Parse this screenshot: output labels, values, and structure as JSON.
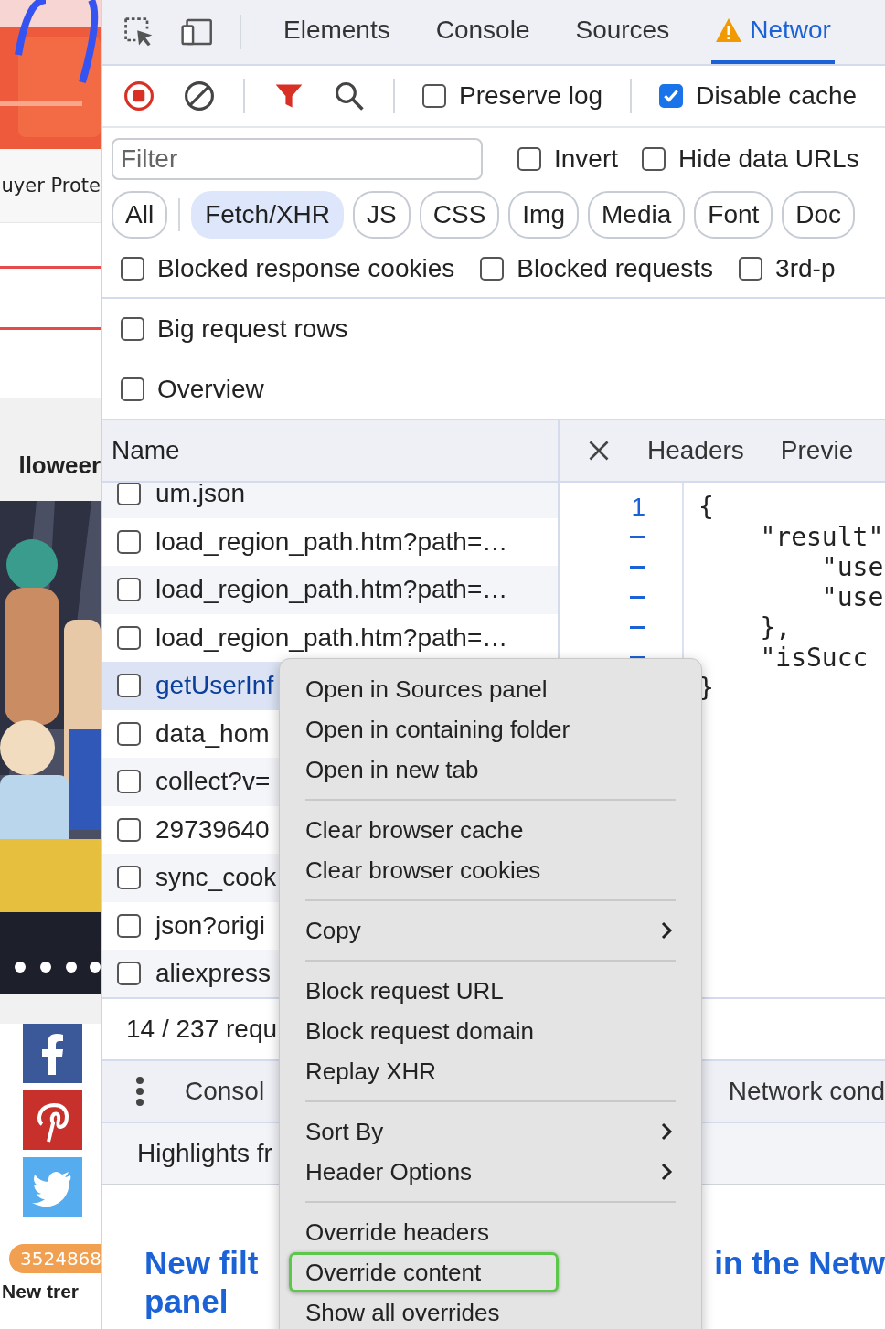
{
  "page": {
    "buyer_text": "uyer Prote",
    "heading": "lloweer",
    "social": [
      {
        "kind": "facebook"
      },
      {
        "kind": "pinterest"
      },
      {
        "kind": "twitter"
      }
    ],
    "count_badge": "3524868",
    "headline": "New trer"
  },
  "devtools": {
    "tabs": [
      {
        "label": "Elements",
        "selected": false,
        "warning": false
      },
      {
        "label": "Console",
        "selected": false,
        "warning": false
      },
      {
        "label": "Sources",
        "selected": false,
        "warning": false
      },
      {
        "label": "Networ",
        "selected": true,
        "warning": true
      }
    ],
    "preserve_log": {
      "label": "Preserve log",
      "checked": false
    },
    "disable_cache": {
      "label": "Disable cache",
      "checked": true
    },
    "filter": {
      "placeholder": "Filter"
    },
    "filter_options": [
      {
        "label": "Invert",
        "checked": false
      },
      {
        "label": "Hide data URLs",
        "checked": false
      }
    ],
    "types": [
      {
        "label": "All",
        "selected": false
      },
      {
        "label": "Fetch/XHR",
        "selected": true
      },
      {
        "label": "JS",
        "selected": false
      },
      {
        "label": "CSS",
        "selected": false
      },
      {
        "label": "Img",
        "selected": false
      },
      {
        "label": "Media",
        "selected": false
      },
      {
        "label": "Font",
        "selected": false
      },
      {
        "label": "Doc",
        "selected": false
      }
    ],
    "blocked_options": [
      {
        "label": "Blocked response cookies",
        "checked": false
      },
      {
        "label": "Blocked requests",
        "checked": false
      },
      {
        "label": "3rd-p",
        "checked": false
      }
    ],
    "options": [
      {
        "label": "Big request rows",
        "checked": false
      },
      {
        "label": "Overview",
        "checked": false
      }
    ],
    "name_header": "Name",
    "detail_tabs": [
      "Headers",
      "Previe"
    ],
    "requests": [
      {
        "name": "um.json",
        "selected": false,
        "checked": false
      },
      {
        "name": "load_region_path.htm?path=…",
        "selected": false,
        "checked": false
      },
      {
        "name": "load_region_path.htm?path=…",
        "selected": false,
        "checked": false
      },
      {
        "name": "load_region_path.htm?path=…",
        "selected": false,
        "checked": false
      },
      {
        "name": "getUserInf",
        "selected": true,
        "checked": false
      },
      {
        "name": "data_hom",
        "selected": false,
        "checked": false
      },
      {
        "name": "collect?v=",
        "selected": false,
        "checked": false
      },
      {
        "name": "29739640",
        "selected": false,
        "checked": false
      },
      {
        "name": "sync_cook",
        "selected": false,
        "checked": false
      },
      {
        "name": "json?origi",
        "selected": false,
        "checked": false
      },
      {
        "name": "aliexpress",
        "selected": false,
        "checked": false
      }
    ],
    "preview": {
      "line_number": "1",
      "lines": [
        "{",
        "    \"result\"",
        "        \"use",
        "        \"use",
        "    },",
        "    \"isSucc",
        "}"
      ]
    },
    "status": "14 / 237 requ",
    "drawer_tabs": [
      "Consol",
      "Network cond"
    ],
    "drawer_title": "Highlights fr",
    "article": {
      "title_start": "New filt",
      "title_end": "in the Netw",
      "title_line2": "panel"
    }
  },
  "context_menu": {
    "groups": [
      [
        {
          "label": "Open in Sources panel",
          "submenu": false,
          "highlighted": false
        },
        {
          "label": "Open in containing folder",
          "submenu": false,
          "highlighted": false
        },
        {
          "label": "Open in new tab",
          "submenu": false,
          "highlighted": false
        }
      ],
      [
        {
          "label": "Clear browser cache",
          "submenu": false,
          "highlighted": false
        },
        {
          "label": "Clear browser cookies",
          "submenu": false,
          "highlighted": false
        }
      ],
      [
        {
          "label": "Copy",
          "submenu": true,
          "highlighted": false
        }
      ],
      [
        {
          "label": "Block request URL",
          "submenu": false,
          "highlighted": false
        },
        {
          "label": "Block request domain",
          "submenu": false,
          "highlighted": false
        },
        {
          "label": "Replay XHR",
          "submenu": false,
          "highlighted": false
        }
      ],
      [
        {
          "label": "Sort By",
          "submenu": true,
          "highlighted": false
        },
        {
          "label": "Header Options",
          "submenu": true,
          "highlighted": false
        }
      ],
      [
        {
          "label": "Override headers",
          "submenu": false,
          "highlighted": false
        },
        {
          "label": "Override content",
          "submenu": false,
          "highlighted": true
        },
        {
          "label": "Show all overrides",
          "submenu": false,
          "highlighted": false
        }
      ]
    ]
  }
}
